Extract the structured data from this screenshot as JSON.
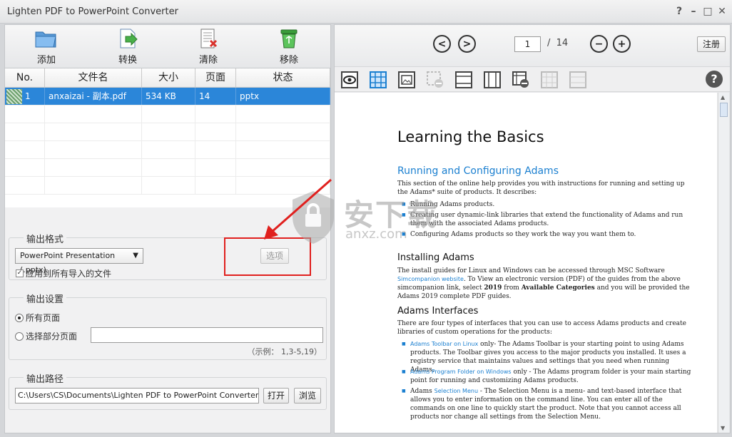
{
  "window": {
    "title": "Lighten PDF to PowerPoint Converter",
    "controls": [
      "?",
      "–",
      "□",
      "✕"
    ]
  },
  "toolbar": {
    "add": "添加",
    "convert": "转换",
    "clear": "清除",
    "remove": "移除"
  },
  "table": {
    "headers": [
      "No.",
      "文件名",
      "大小",
      "页面",
      "状态"
    ],
    "rows": [
      {
        "no": "1",
        "name": "anxaizai - 副本.pdf",
        "size": "534 KB",
        "pages": "14",
        "status": "pptx"
      }
    ]
  },
  "output_format": {
    "title": "输出格式",
    "selected": "PowerPoint Presentation (.pptx)",
    "options_button": "选项",
    "apply_all": "应用到所有导入的文件",
    "apply_all_checked": true
  },
  "output_settings": {
    "title": "输出设置",
    "all_pages": "所有页面",
    "select_pages": "选择部分页面",
    "selected_mode": "all",
    "pages_value": "",
    "example": "（示例： 1,3-5,19）"
  },
  "output_path": {
    "title": "输出路径",
    "path": "C:\\Users\\CS\\Documents\\Lighten PDF to PowerPoint Converter",
    "open": "打开",
    "browse": "浏览"
  },
  "viewer": {
    "prev": "<",
    "next": ">",
    "current_page": "1",
    "separator": "/",
    "total_pages": "14",
    "zoom_out": "−",
    "zoom_in": "+",
    "register": "注册",
    "help": "?"
  },
  "doc": {
    "h1": "Learning the Basics",
    "h2_running": "Running and Configuring Adams",
    "p_running": "This section of the online help provides you with instructions for running and setting up the Adams* suite of products. It describes:",
    "li_1": "Running Adams products.",
    "li_2": "Creating user dynamic-link libraries that extend the functionality of Adams and run them with the associated Adams products.",
    "li_3": "Configuring Adams products so they work the way you want them to.",
    "h3_installing": "Installing Adams",
    "p_installing_a": "The install guides for Linux and Windows can be accessed through MSC Software ",
    "p_installing_link": "Simcompanion website",
    "p_installing_b": ". To View an electronic version (PDF) of the guides from the above simcompanion link, select ",
    "p_installing_bold1": "2019",
    "p_installing_c": " from ",
    "p_installing_bold2": "Available Categories",
    "p_installing_d": " and you will be provided the Adams 2019 complete PDF guides.",
    "h3_interfaces": "Adams Interfaces",
    "p_interfaces": "There are four types of interfaces that you can use to access Adams products and create libraries of custom operations for the products:",
    "if_1_link": "Adams Toolbar on Linux",
    "if_1_text": " only- The Adams Toolbar is your starting point to using Adams products. The Toolbar gives you access to the major products you installed. It uses a registry service that maintains values and settings that you need when running Adams.",
    "if_2_link": "Adams Program Folder on Windows",
    "if_2_text": " only - The Adams program folder is your main starting point for running and customizing Adams products.",
    "if_3_pre": "Adams ",
    "if_3_link": "Selection Menu",
    "if_3_text": " - The Selection Menu is a menu- and text-based interface that allows you to enter information on the command line. You can enter all of the commands on one line to quickly start the product. Note that you cannot access all products nor change all settings from the Selection Menu."
  },
  "watermark": {
    "text": "安下载",
    "sub": "anxz.com"
  },
  "colors": {
    "selection": "#2b86d9",
    "accent_blue": "#1a7fd0",
    "annotation_red": "#e0201e"
  }
}
